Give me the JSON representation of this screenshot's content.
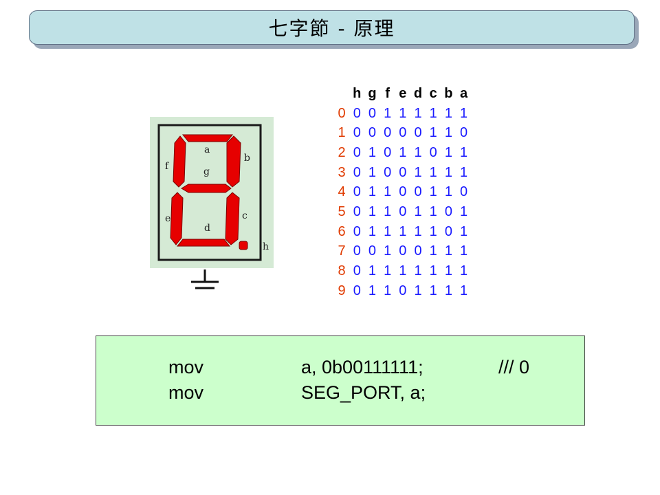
{
  "title": "七字節 - 原理",
  "segment_labels": {
    "a": "a",
    "b": "b",
    "c": "c",
    "d": "d",
    "e": "e",
    "f": "f",
    "g": "g",
    "h": "h"
  },
  "colors": {
    "segment": "#e60000",
    "table_bits": "#1a1aff",
    "table_digits": "#e03a00",
    "code_bg": "#ccffcc",
    "title_bg": "#bfe1e6"
  },
  "truth_table": {
    "header": [
      "h",
      "g",
      "f",
      "e",
      "d",
      "c",
      "b",
      "a"
    ],
    "rows": [
      {
        "digit": "0",
        "bits": [
          "0",
          "0",
          "1",
          "1",
          "1",
          "1",
          "1",
          "1"
        ]
      },
      {
        "digit": "1",
        "bits": [
          "0",
          "0",
          "0",
          "0",
          "0",
          "1",
          "1",
          "0"
        ]
      },
      {
        "digit": "2",
        "bits": [
          "0",
          "1",
          "0",
          "1",
          "1",
          "0",
          "1",
          "1"
        ]
      },
      {
        "digit": "3",
        "bits": [
          "0",
          "1",
          "0",
          "0",
          "1",
          "1",
          "1",
          "1"
        ]
      },
      {
        "digit": "4",
        "bits": [
          "0",
          "1",
          "1",
          "0",
          "0",
          "1",
          "1",
          "0"
        ]
      },
      {
        "digit": "5",
        "bits": [
          "0",
          "1",
          "1",
          "0",
          "1",
          "1",
          "0",
          "1"
        ]
      },
      {
        "digit": "6",
        "bits": [
          "0",
          "1",
          "1",
          "1",
          "1",
          "1",
          "0",
          "1"
        ]
      },
      {
        "digit": "7",
        "bits": [
          "0",
          "0",
          "1",
          "0",
          "0",
          "1",
          "1",
          "1"
        ]
      },
      {
        "digit": "8",
        "bits": [
          "0",
          "1",
          "1",
          "1",
          "1",
          "1",
          "1",
          "1"
        ]
      },
      {
        "digit": "9",
        "bits": [
          "0",
          "1",
          "1",
          "0",
          "1",
          "1",
          "1",
          "1"
        ]
      }
    ]
  },
  "code": {
    "line1": {
      "op": "mov",
      "args": "a, 0b00111111;",
      "comment": "/// 0"
    },
    "line2": {
      "op": "mov",
      "args": "SEG_PORT, a;"
    }
  }
}
